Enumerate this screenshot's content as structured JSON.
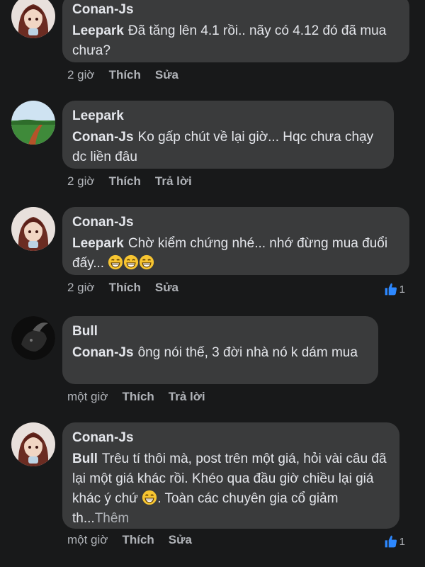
{
  "comments": [
    {
      "author": "Conan-Js",
      "mention": "Leepark",
      "text": "Đã tăng lên 4.1 rồi.. nãy có 4.12 đó đã mua chưa?",
      "time": "2 giờ",
      "like": "Thích",
      "action": "Sửa"
    },
    {
      "author": "Leepark",
      "mention": "Conan-Js",
      "text": "Ko gấp chút về lại giờ... Hqc chưa chạy dc liền đâu",
      "time": "2 giờ",
      "like": "Thích",
      "action": "Trả lời"
    },
    {
      "author": "Conan-Js",
      "mention": "Leepark",
      "text": "Chờ kiểm chứng nhé... nhớ đừng mua đuổi đấy...",
      "time": "2 giờ",
      "like": "Thích",
      "action": "Sửa",
      "reaction_count": "1"
    },
    {
      "author": "Bull",
      "mention": "Conan-Js",
      "text": "ông nói thế, 3 đời nhà nó k dám mua",
      "time": "một giờ",
      "like": "Thích",
      "action": "Trả lời"
    },
    {
      "author": "Conan-Js",
      "mention": "Bull",
      "text_a": "Trêu tí thôi mà, post trên một giá, hỏi vài câu đã lại một giá khác rồi. Khéo qua đầu giờ chiều lại giá khác ý chứ",
      "text_b": ". Toàn các chuyên gia cổ giảm th...",
      "more": "Thêm",
      "time": "một giờ",
      "like": "Thích",
      "action": "Sửa",
      "reaction_count": "1"
    }
  ],
  "colors": {
    "background": "#18191a",
    "bubble": "#3a3b3c",
    "like_blue": "#2d88ff"
  }
}
